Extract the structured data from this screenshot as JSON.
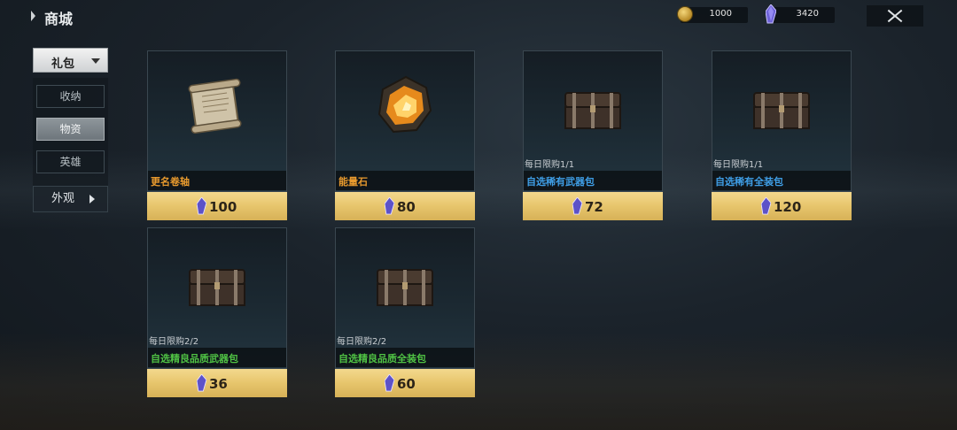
{
  "header": {
    "title": "商城"
  },
  "currency": {
    "gold": "1000",
    "gems": "3420"
  },
  "sidebar": {
    "category": "礼包",
    "items": [
      {
        "label": "收纳",
        "active": false
      },
      {
        "label": "物资",
        "active": true
      },
      {
        "label": "英雄",
        "active": false
      }
    ],
    "appearance": "外观"
  },
  "items": [
    {
      "name": "更名卷轴",
      "price": "100",
      "limit": "",
      "quality": "orange",
      "icon": "scroll-icon"
    },
    {
      "name": "能量石",
      "price": "80",
      "limit": "",
      "quality": "orange",
      "icon": "energy-stone-icon"
    },
    {
      "name": "自选稀有武器包",
      "price": "72",
      "limit": "每日限购1/1",
      "quality": "blue",
      "icon": "chest-icon"
    },
    {
      "name": "自选稀有全装包",
      "price": "120",
      "limit": "每日限购1/1",
      "quality": "blue",
      "icon": "chest-icon"
    },
    {
      "name": "自选精良品质武器包",
      "price": "36",
      "limit": "每日限购2/2",
      "quality": "green",
      "icon": "chest-icon"
    },
    {
      "name": "自选精良品质全装包",
      "price": "60",
      "limit": "每日限购2/2",
      "quality": "green",
      "icon": "chest-icon"
    }
  ],
  "colors": {
    "orange": "#e89a2e",
    "blue": "#3f9ee6",
    "green": "#4fc144",
    "price_bar": "#e7c56c"
  }
}
